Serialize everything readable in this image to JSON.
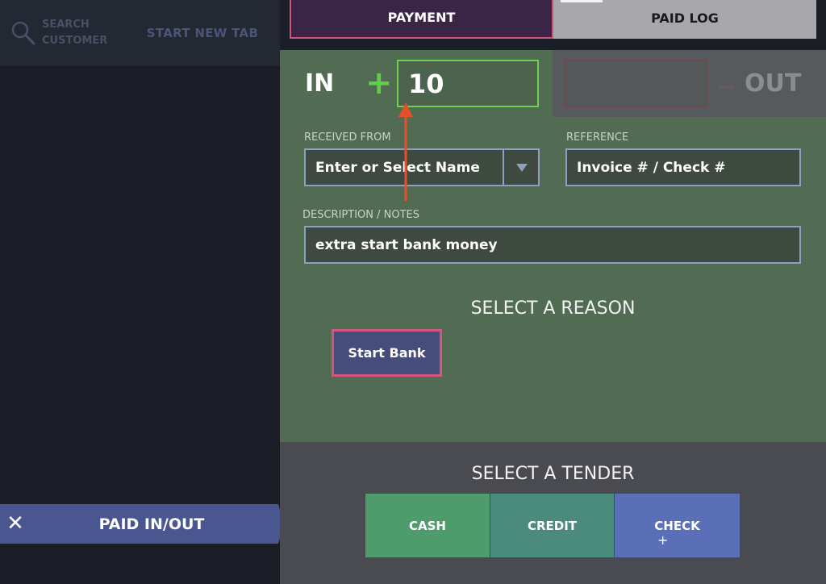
{
  "left": {
    "search_customer_line1": "SEARCH",
    "search_customer_line2": "CUSTOMER",
    "start_new_tab": "START NEW TAB",
    "paid_inout_close": "✕",
    "paid_inout_title": "PAID IN/OUT"
  },
  "tabs": {
    "payment": "PAYMENT",
    "paid_log": "PAID LOG"
  },
  "amounts": {
    "in_label": "IN",
    "plus": "+",
    "in_value": "10",
    "minus": "−",
    "out_label": "OUT",
    "out_value": ""
  },
  "form": {
    "received_from_label": "RECEIVED FROM",
    "received_from_placeholder": "Enter or Select Name",
    "reference_label": "REFERENCE",
    "reference_placeholder": "Invoice # / Check #",
    "description_label": "DESCRIPTION / NOTES",
    "description_value": "extra start bank money"
  },
  "reasons": {
    "title": "SELECT A REASON",
    "items": [
      "Start Bank"
    ]
  },
  "tender": {
    "title": "SELECT A TENDER",
    "cash": "CASH",
    "credit": "CREDIT",
    "check": "CHECK"
  },
  "icons": {
    "search": "search-icon",
    "close": "close-icon",
    "dropdown": "chevron-down-icon",
    "annotation": "red-arrow-up"
  },
  "colors": {
    "accent_pink": "#d2527e",
    "in_green": "#6fd24e",
    "form_bg": "#526c53",
    "cash": "#4e9c6c",
    "credit": "#4a8b7e",
    "check": "#5a6fb8",
    "paid_inout": "#4a5690",
    "arrow": "#e5502a"
  }
}
